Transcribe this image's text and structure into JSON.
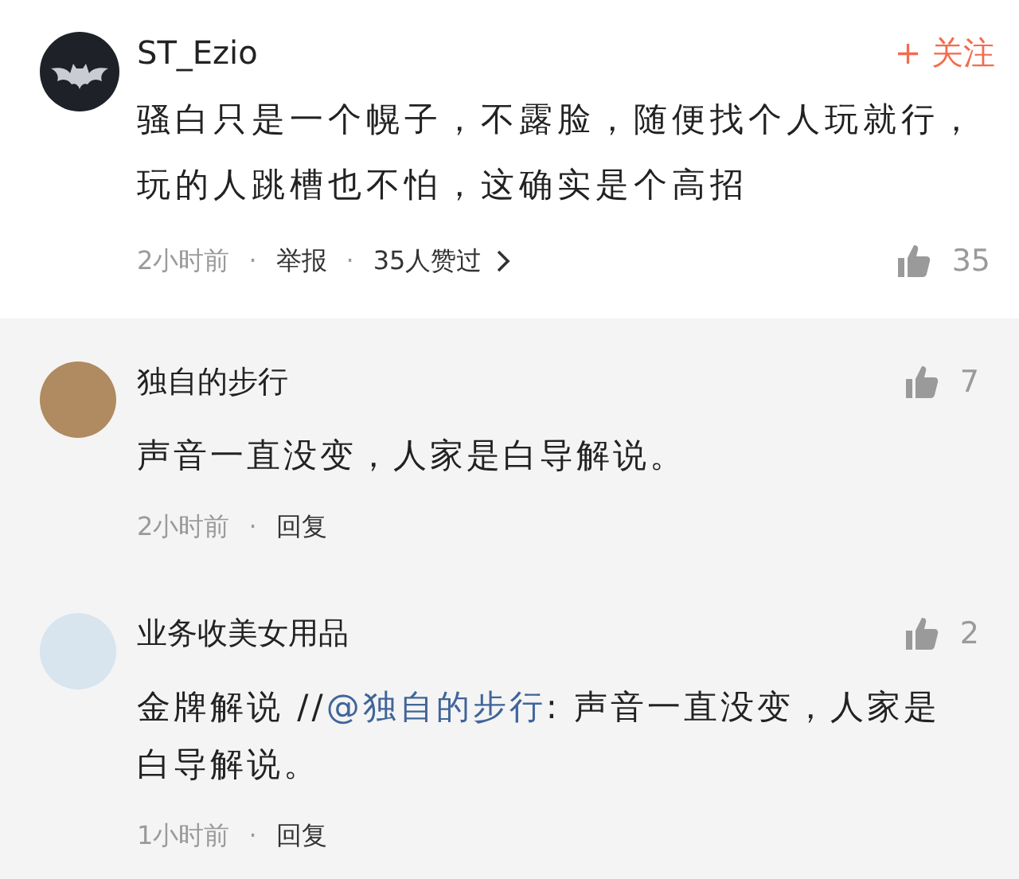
{
  "comment": {
    "author": "ST_Ezio",
    "follow": "+ 关注",
    "body": "骚白只是一个幌子，不露脸，随便找个人玩就行，玩的人跳槽也不怕，这确实是个高招",
    "meta": [
      {
        "kind": "time",
        "text": "2小时前"
      },
      {
        "kind": "sep",
        "text": "·"
      },
      {
        "kind": "action",
        "text": "举报"
      },
      {
        "kind": "sep",
        "text": "·"
      },
      {
        "kind": "link",
        "text": "35人赞过"
      }
    ],
    "likes": "35"
  },
  "replies": [
    {
      "author": "独自的步行",
      "body": [
        {
          "kind": "text",
          "text": "声音一直没变，人家是白导解说。"
        }
      ],
      "meta": [
        {
          "kind": "time",
          "text": "2小时前"
        },
        {
          "kind": "sep",
          "text": "·"
        },
        {
          "kind": "action",
          "text": "回复"
        }
      ],
      "likes": "7"
    },
    {
      "author": "业务收美女用品",
      "body": [
        {
          "kind": "text",
          "text": "金牌解说 //"
        },
        {
          "kind": "mention",
          "text": "@独自的步行"
        },
        {
          "kind": "text",
          "text": ": 声音一直没变，人家是白导解说。"
        }
      ],
      "meta": [
        {
          "kind": "time",
          "text": "1小时前"
        },
        {
          "kind": "sep",
          "text": "·"
        },
        {
          "kind": "action",
          "text": "回复"
        }
      ],
      "likes": "2"
    }
  ]
}
